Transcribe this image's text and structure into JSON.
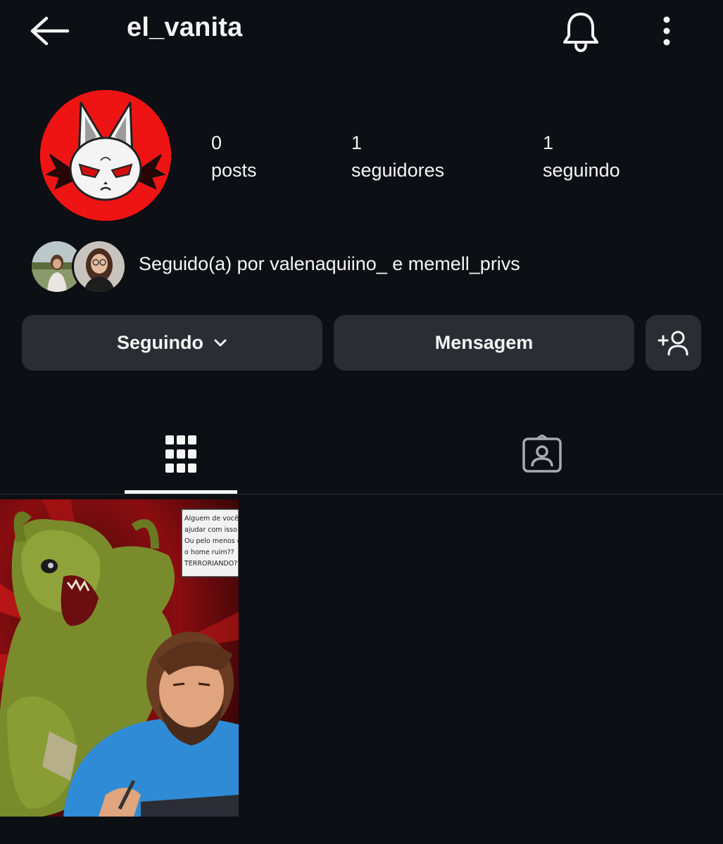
{
  "header": {
    "username": "el_vanita",
    "back_icon": "arrow-left-icon",
    "notifications_icon": "bell-icon",
    "more_icon": "more-vertical-icon"
  },
  "profile": {
    "avatar_icon": "cat-demon-avatar",
    "accent_color": "#ef1414"
  },
  "stats": {
    "posts": {
      "count": "0",
      "label": "posts"
    },
    "followers": {
      "count": "1",
      "label": "seguidores"
    },
    "following": {
      "count": "1",
      "label": "seguindo"
    }
  },
  "followed_by": {
    "text": "Seguido(a) por valenaquiino_ e memell_privs"
  },
  "actions": {
    "following_label": "Seguindo",
    "message_label": "Mensagem",
    "add_user_icon": "add-person-icon"
  },
  "tabs": {
    "grid_icon": "grid-icon",
    "tagged_icon": "tagged-person-icon"
  },
  "post": {
    "speech_lines": [
      "Alguem de vocês pode",
      "ajudar com isso aqui??",
      "Ou pelo menos distrair",
      "o home ruim??",
      "TERRORIANDO????"
    ]
  }
}
